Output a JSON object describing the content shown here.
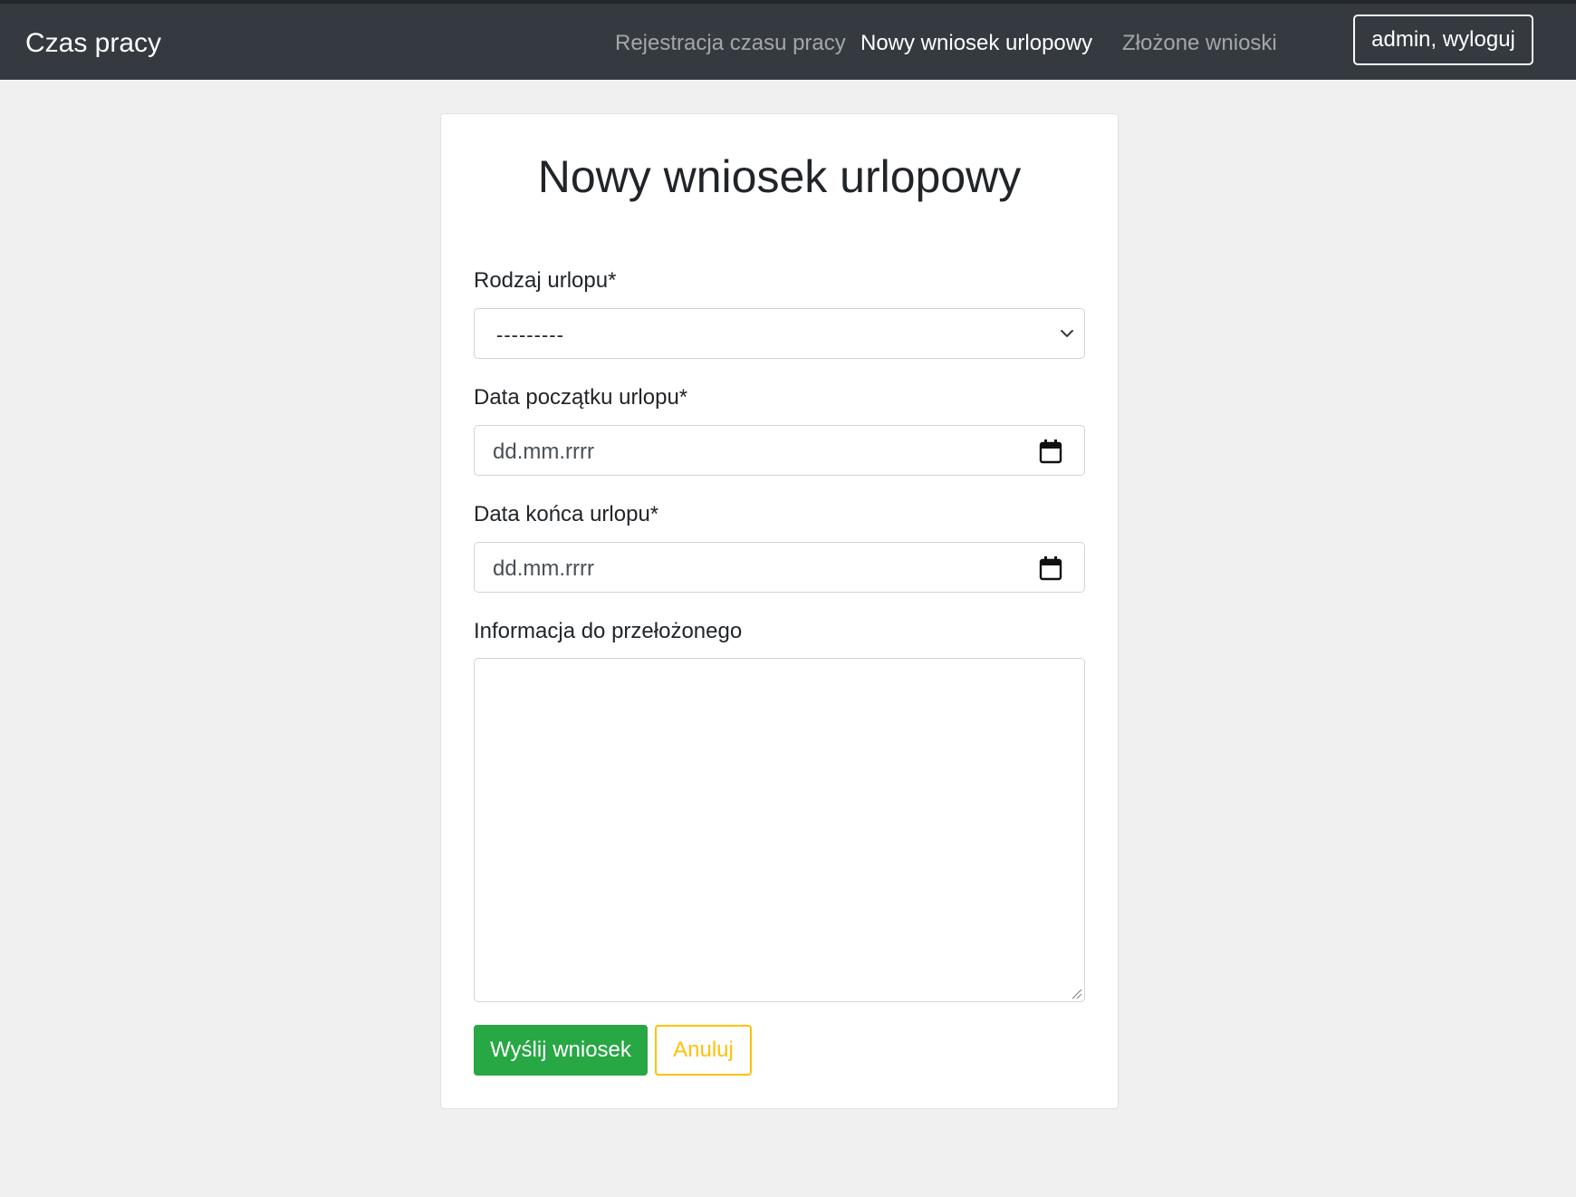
{
  "navbar": {
    "brand": "Czas pracy",
    "links": [
      {
        "label": "Rejestracja czasu pracy",
        "active": false
      },
      {
        "label": "Nowy wniosek urlopowy",
        "active": true
      },
      {
        "label": "Złożone wnioski",
        "active": false
      }
    ],
    "logout_label": "admin, wyloguj"
  },
  "form": {
    "title": "Nowy wniosek urlopowy",
    "leave_type": {
      "label": "Rodzaj urlopu*",
      "selected": "---------"
    },
    "start_date": {
      "label": "Data początku urlopu*",
      "placeholder": "dd.mm.rrrr",
      "icon": "calendar-icon"
    },
    "end_date": {
      "label": "Data końca urlopu*",
      "placeholder": "dd.mm.rrrr",
      "icon": "calendar-icon"
    },
    "note": {
      "label": "Informacja do przełożonego",
      "value": ""
    },
    "submit_label": "Wyślij wniosek",
    "cancel_label": "Anuluj"
  },
  "colors": {
    "navbar_bg": "#343a40",
    "page_bg": "#f0f0f0",
    "success": "#28a745",
    "warning": "#ffc107"
  }
}
